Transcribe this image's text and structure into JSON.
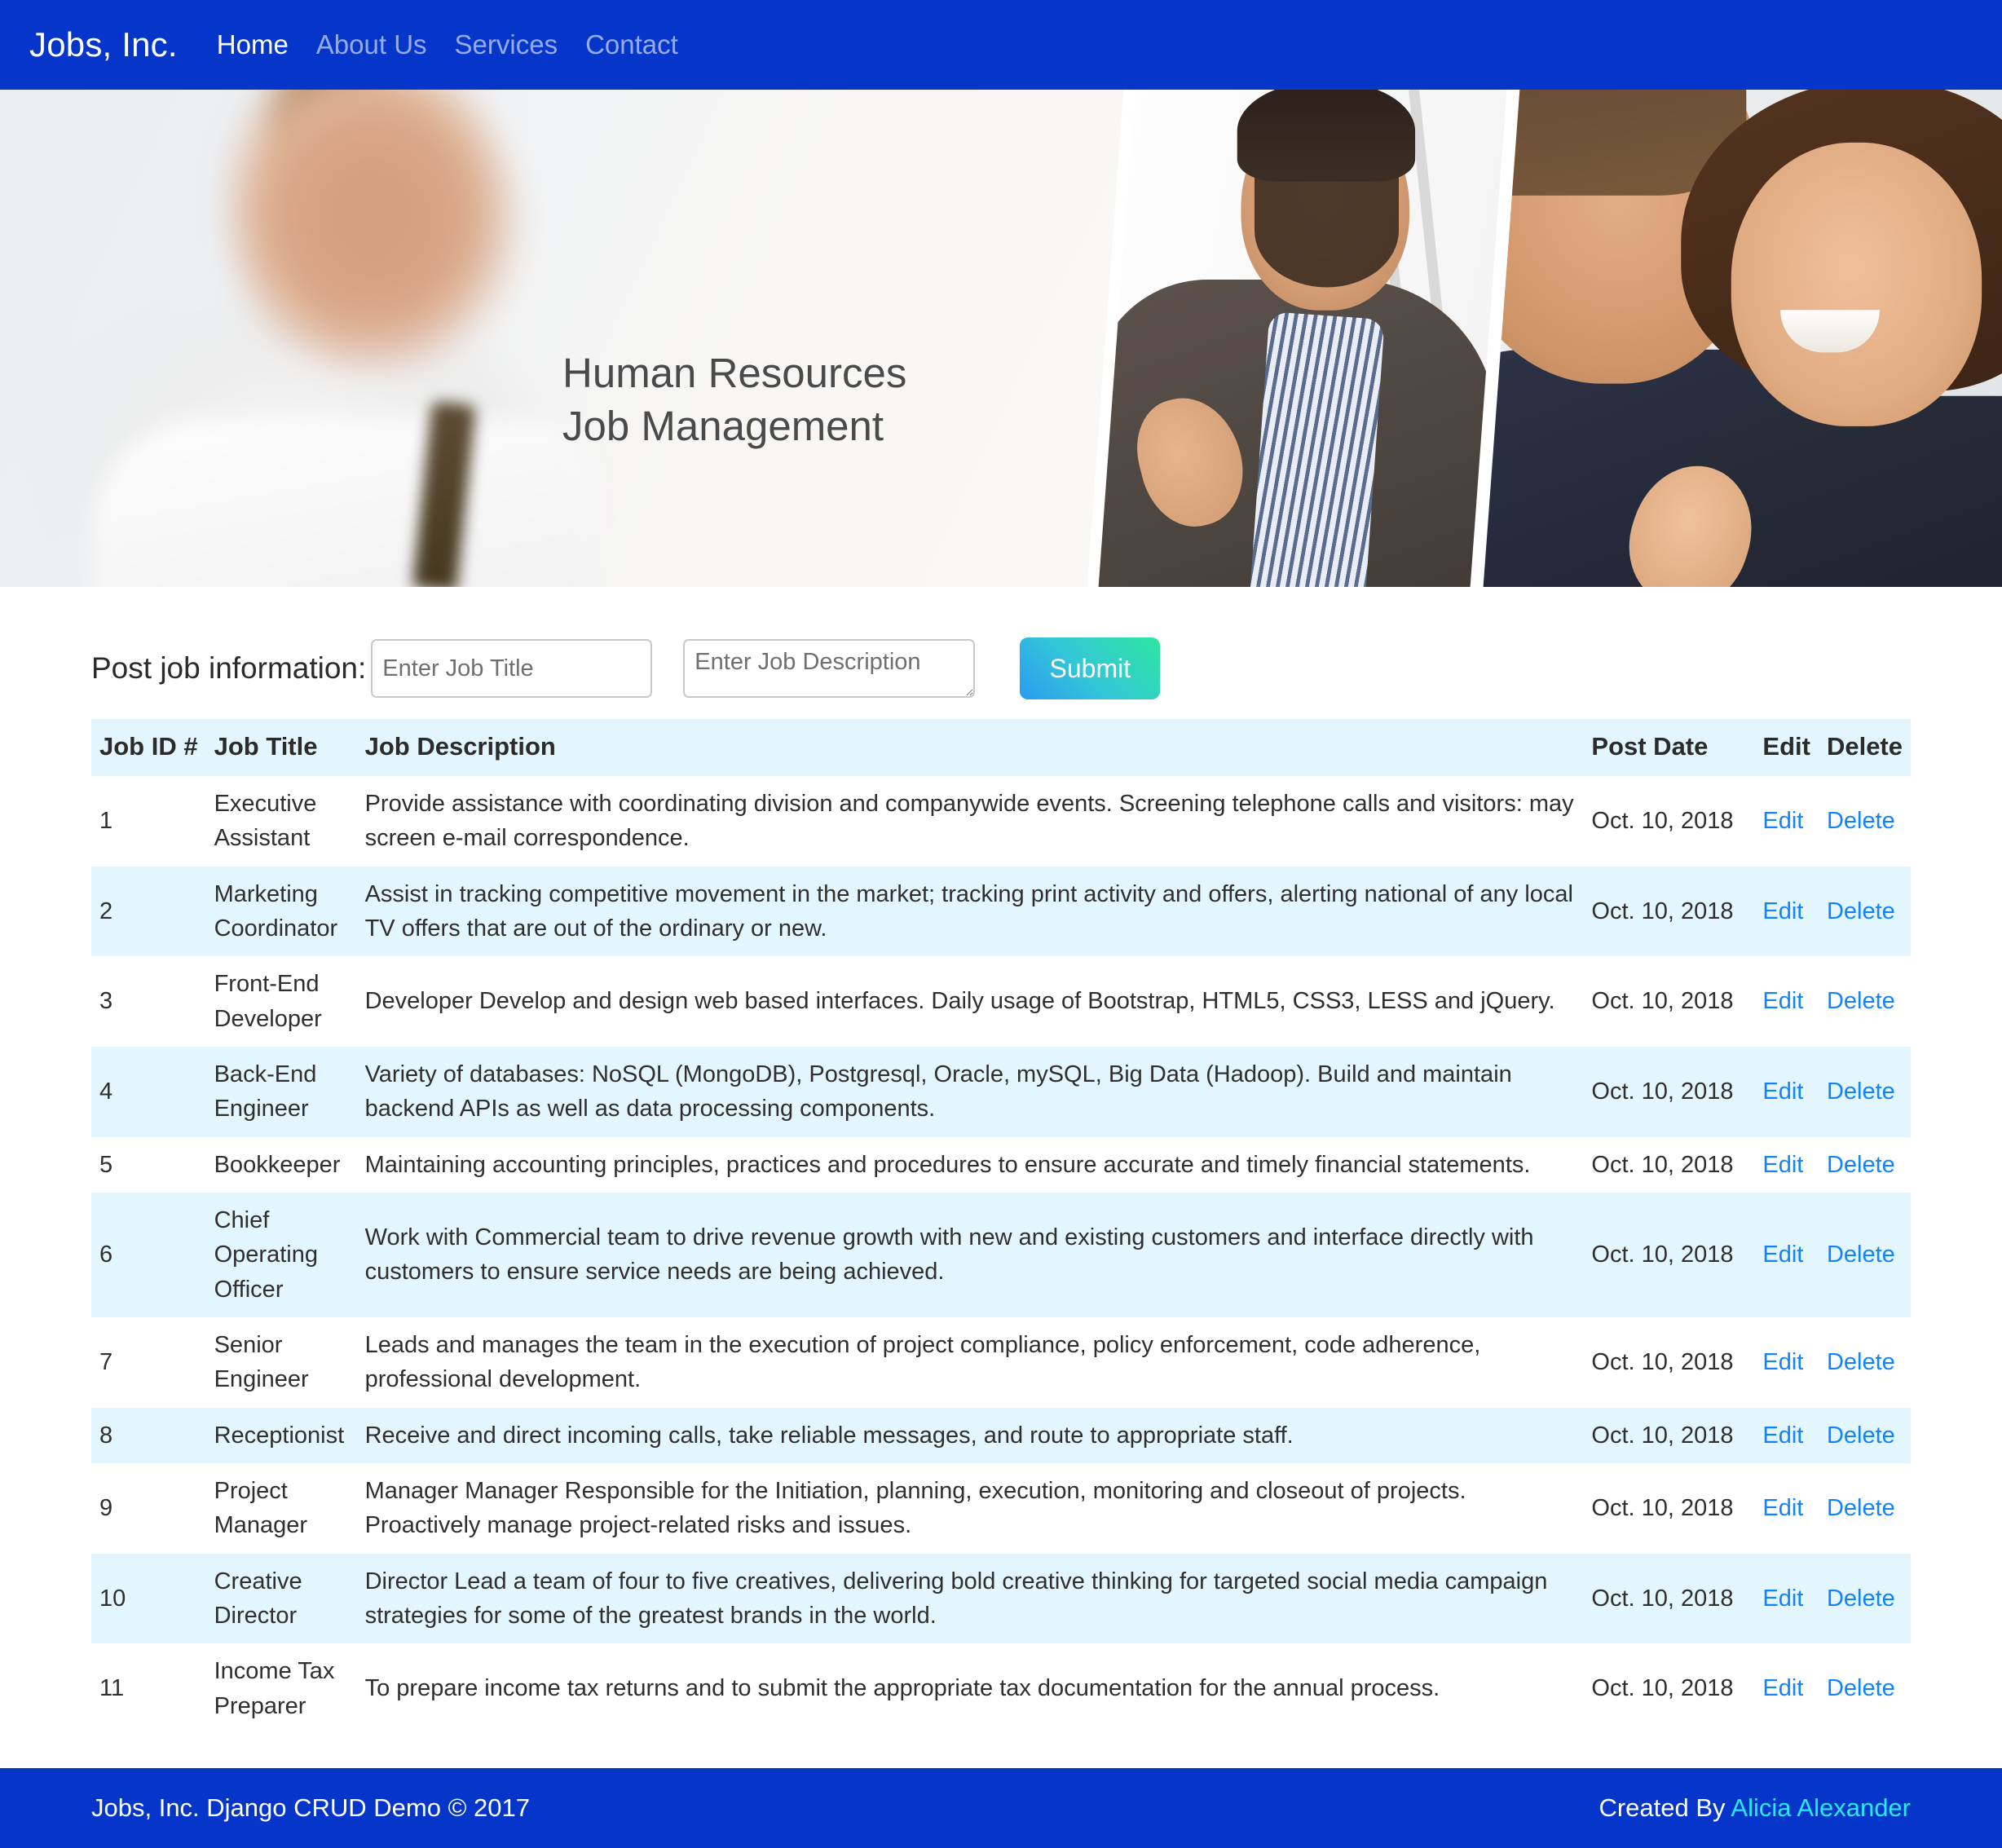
{
  "navbar": {
    "brand": "Jobs, Inc.",
    "links": [
      {
        "label": "Home",
        "active": true
      },
      {
        "label": "About Us",
        "active": false
      },
      {
        "label": "Services",
        "active": false
      },
      {
        "label": "Contact",
        "active": false
      }
    ]
  },
  "hero": {
    "title_line1": "Human Resources",
    "title_line2": "Job Management"
  },
  "form": {
    "label": "Post job information:",
    "title_placeholder": "Enter Job Title",
    "title_value": "",
    "description_placeholder": "Enter Job Description",
    "description_value": "",
    "submit_label": "Submit"
  },
  "table": {
    "headers": {
      "id": "Job ID #",
      "title": "Job Title",
      "description": "Job Description",
      "date": "Post Date",
      "edit": "Edit",
      "delete": "Delete"
    },
    "edit_label": "Edit",
    "delete_label": "Delete",
    "rows": [
      {
        "id": "1",
        "title": "Executive Assistant",
        "description": "Provide assistance with coordinating division and companywide events. Screening telephone calls and visitors: may screen e-mail correspondence.",
        "date": "Oct. 10, 2018"
      },
      {
        "id": "2",
        "title": "Marketing Coordinator",
        "description": "Assist in tracking competitive movement in the market; tracking print activity and offers, alerting national of any local TV offers that are out of the ordinary or new.",
        "date": "Oct. 10, 2018"
      },
      {
        "id": "3",
        "title": "Front-End Developer",
        "description": "Developer Develop and design web based interfaces. Daily usage of Bootstrap, HTML5, CSS3, LESS and jQuery.",
        "date": "Oct. 10, 2018"
      },
      {
        "id": "4",
        "title": "Back-End Engineer",
        "description": "Variety of databases: NoSQL (MongoDB), Postgresql, Oracle, mySQL, Big Data (Hadoop). Build and maintain backend APIs as well as data processing components.",
        "date": "Oct. 10, 2018"
      },
      {
        "id": "5",
        "title": "Bookkeeper",
        "description": "Maintaining accounting principles, practices and procedures to ensure accurate and timely financial statements.",
        "date": "Oct. 10, 2018"
      },
      {
        "id": "6",
        "title": "Chief Operating Officer",
        "description": "Work with Commercial team to drive revenue growth with new and existing customers and interface directly with customers to ensure service needs are being achieved.",
        "date": "Oct. 10, 2018"
      },
      {
        "id": "7",
        "title": "Senior Engineer",
        "description": "Leads and manages the team in the execution of project compliance, policy enforcement, code adherence, professional development.",
        "date": "Oct. 10, 2018"
      },
      {
        "id": "8",
        "title": "Receptionist",
        "description": "Receive and direct incoming calls, take reliable messages, and route to appropriate staff.",
        "date": "Oct. 10, 2018"
      },
      {
        "id": "9",
        "title": "Project Manager",
        "description": "Manager Manager Responsible for the Initiation, planning, execution, monitoring and closeout of projects. Proactively manage project-related risks and issues.",
        "date": "Oct. 10, 2018"
      },
      {
        "id": "10",
        "title": "Creative Director",
        "description": "Director Lead a team of four to five creatives, delivering bold creative thinking for targeted social media campaign strategies for some of the greatest brands in the world.",
        "date": "Oct. 10, 2018"
      },
      {
        "id": "11",
        "title": "Income Tax Preparer",
        "description": "To prepare income tax returns and to submit the appropriate tax documentation for the annual process.",
        "date": "Oct. 10, 2018"
      }
    ]
  },
  "footer": {
    "copyright": "Jobs, Inc. Django CRUD Demo © 2017",
    "created_by_prefix": "Created By ",
    "author": "Alicia Alexander"
  },
  "colors": {
    "brand_blue": "#0636c9",
    "table_stripe": "#e3f5fd",
    "link_blue": "#1283ff",
    "author_cyan": "#29e9f5"
  }
}
